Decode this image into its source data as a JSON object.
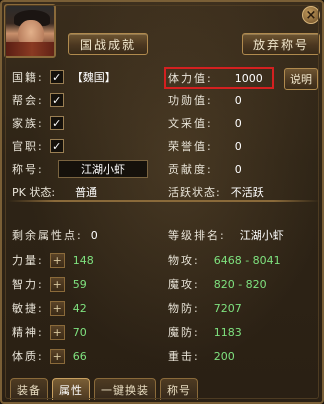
{
  "header": {
    "achievement_button": "国战成就",
    "abandon_title_button": "放弃称号",
    "close_symbol": "×"
  },
  "info": {
    "nationality": {
      "label": "国籍:",
      "checked": "✓",
      "value": "【魏国】"
    },
    "guild": {
      "label": "帮会:",
      "checked": "✓"
    },
    "clan": {
      "label": "家族:",
      "checked": "✓"
    },
    "office": {
      "label": "官职:",
      "checked": "✓"
    },
    "title": {
      "label": "称号:",
      "value": "江湖小虾"
    },
    "pk_status": {
      "label": "PK 状态:",
      "value": "普通"
    },
    "strength_value": {
      "label": "体力值:",
      "value": "1000"
    },
    "merit_value": {
      "label": "功勋值:",
      "value": "0"
    },
    "literary_value": {
      "label": "文采值:",
      "value": "0"
    },
    "honor_value": {
      "label": "荣誉值:",
      "value": "0"
    },
    "contribution": {
      "label": "贡献度:",
      "value": "0"
    },
    "active_status": {
      "label": "活跃状态:",
      "value": "不活跃"
    },
    "explain_button": "说明"
  },
  "stats": {
    "remaining_points": {
      "label": "剩余属性点:",
      "value": "0"
    },
    "level_rank": {
      "label": "等级排名:",
      "value": "江湖小虾"
    },
    "rows": [
      {
        "left_label": "力量:",
        "left_value": "148",
        "right_label": "物攻:",
        "right_value": "6468 - 8041"
      },
      {
        "left_label": "智力:",
        "left_value": "59",
        "right_label": "魔攻:",
        "right_value": "820 - 820"
      },
      {
        "left_label": "敏捷:",
        "left_value": "42",
        "right_label": "物防:",
        "right_value": "7207"
      },
      {
        "left_label": "精神:",
        "left_value": "70",
        "right_label": "魔防:",
        "right_value": "1183"
      },
      {
        "left_label": "体质:",
        "left_value": "66",
        "right_label": "重击:",
        "right_value": "200"
      }
    ],
    "plus_symbol": "+"
  },
  "tabs": [
    {
      "label": "装备"
    },
    {
      "label": "属性"
    },
    {
      "label": "一键换装"
    },
    {
      "label": "称号"
    }
  ],
  "active_tab": "属性",
  "colors": {
    "highlight": "#d42020",
    "stat_value": "#7fe27f"
  }
}
